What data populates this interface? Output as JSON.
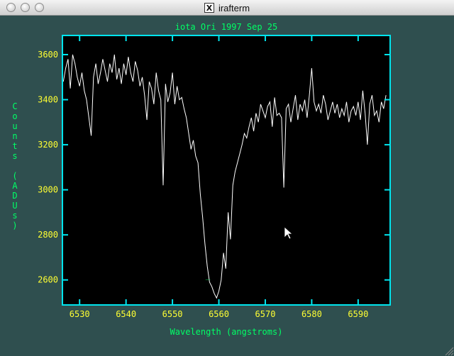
{
  "window": {
    "title": "irafterm",
    "background": "#2f4f4f",
    "buttons": [
      "close-button",
      "minimize-button",
      "zoom-button"
    ]
  },
  "plot": {
    "colors": {
      "background": "#000000",
      "frame": "#00e5ee",
      "title": "#00ff66",
      "xlabel": "#00ff66",
      "ylabel": "#00ff66",
      "ticks": "#ffff33",
      "spectrum": "#ffffff",
      "marker": "#00ff66"
    },
    "marker_glyph": "_"
  },
  "chart_data": {
    "type": "line",
    "title": "iota Ori 1997 Sep 25",
    "xlabel": "Wavelength (angstroms)",
    "ylabel": "Counts (ADUs)",
    "xlim": [
      6526.3,
      6596.9
    ],
    "ylim": [
      2489,
      3685
    ],
    "xticks": [
      6530,
      6540,
      6550,
      6560,
      6570,
      6580,
      6590
    ],
    "yticks": [
      2600,
      2800,
      3000,
      3200,
      3400,
      3600
    ],
    "grid": false,
    "series": [
      {
        "x": [
          6526.5,
          6527.0,
          6527.5,
          6528.0,
          6528.5,
          6529.0,
          6529.5,
          6530.0,
          6530.5,
          6531.0,
          6531.5,
          6532.0,
          6532.5,
          6533.0,
          6533.5,
          6534.0,
          6534.5,
          6535.0,
          6535.5,
          6536.0,
          6536.5,
          6537.0,
          6537.5,
          6538.0,
          6538.5,
          6539.0,
          6539.5,
          6540.0,
          6540.5,
          6541.0,
          6541.5,
          6542.0,
          6542.5,
          6543.0,
          6543.5,
          6544.0,
          6544.5,
          6545.0,
          6545.5,
          6546.0,
          6546.5,
          6547.0,
          6547.5,
          6548.0,
          6548.5,
          6549.0,
          6549.5,
          6550.0,
          6550.5,
          6551.0,
          6551.5,
          6552.0,
          6552.5,
          6553.0,
          6553.5,
          6554.0,
          6554.5,
          6555.0,
          6555.5,
          6556.0,
          6556.5,
          6557.0,
          6557.5,
          6558.0,
          6558.5,
          6559.0,
          6559.5,
          6560.0,
          6560.5,
          6561.0,
          6561.5,
          6562.0,
          6562.5,
          6563.0,
          6563.5,
          6564.0,
          6564.5,
          6565.0,
          6565.5,
          6566.0,
          6566.5,
          6567.0,
          6567.5,
          6568.0,
          6568.5,
          6569.0,
          6569.5,
          6570.0,
          6570.5,
          6571.0,
          6571.5,
          6572.0,
          6572.5,
          6573.0,
          6573.5,
          6574.0,
          6574.5,
          6575.0,
          6575.5,
          6576.0,
          6576.5,
          6577.0,
          6577.5,
          6578.0,
          6578.5,
          6579.0,
          6579.5,
          6580.0,
          6580.5,
          6581.0,
          6581.5,
          6582.0,
          6582.5,
          6583.0,
          6583.5,
          6584.0,
          6584.5,
          6585.0,
          6585.5,
          6586.0,
          6586.5,
          6587.0,
          6587.5,
          6588.0,
          6588.5,
          6589.0,
          6589.5,
          6590.0,
          6590.5,
          6591.0,
          6591.5,
          6592.0,
          6592.5,
          6593.0,
          6593.5,
          6594.0,
          6594.5,
          6595.0,
          6595.5,
          6596.0
        ],
        "y": [
          3480,
          3540,
          3580,
          3450,
          3600,
          3560,
          3500,
          3460,
          3520,
          3440,
          3400,
          3320,
          3240,
          3500,
          3560,
          3470,
          3520,
          3580,
          3530,
          3480,
          3560,
          3520,
          3600,
          3490,
          3540,
          3470,
          3560,
          3510,
          3590,
          3520,
          3480,
          3570,
          3530,
          3460,
          3500,
          3420,
          3310,
          3480,
          3450,
          3380,
          3520,
          3440,
          3400,
          3020,
          3470,
          3390,
          3430,
          3520,
          3380,
          3460,
          3400,
          3410,
          3360,
          3320,
          3250,
          3180,
          3220,
          3150,
          3120,
          2980,
          2880,
          2760,
          2660,
          2590,
          2570,
          2540,
          2520,
          2550,
          2600,
          2720,
          2650,
          2900,
          2780,
          3020,
          3080,
          3120,
          3160,
          3200,
          3250,
          3230,
          3280,
          3320,
          3260,
          3340,
          3300,
          3380,
          3350,
          3320,
          3370,
          3390,
          3280,
          3410,
          3330,
          3340,
          3320,
          3010,
          3360,
          3380,
          3300,
          3360,
          3420,
          3310,
          3380,
          3350,
          3400,
          3320,
          3420,
          3540,
          3390,
          3350,
          3380,
          3340,
          3420,
          3380,
          3310,
          3350,
          3390,
          3340,
          3380,
          3320,
          3360,
          3330,
          3390,
          3300,
          3350,
          3370,
          3330,
          3390,
          3310,
          3440,
          3340,
          3200,
          3380,
          3420,
          3330,
          3350,
          3300,
          3390,
          3360,
          3420
        ]
      }
    ]
  }
}
